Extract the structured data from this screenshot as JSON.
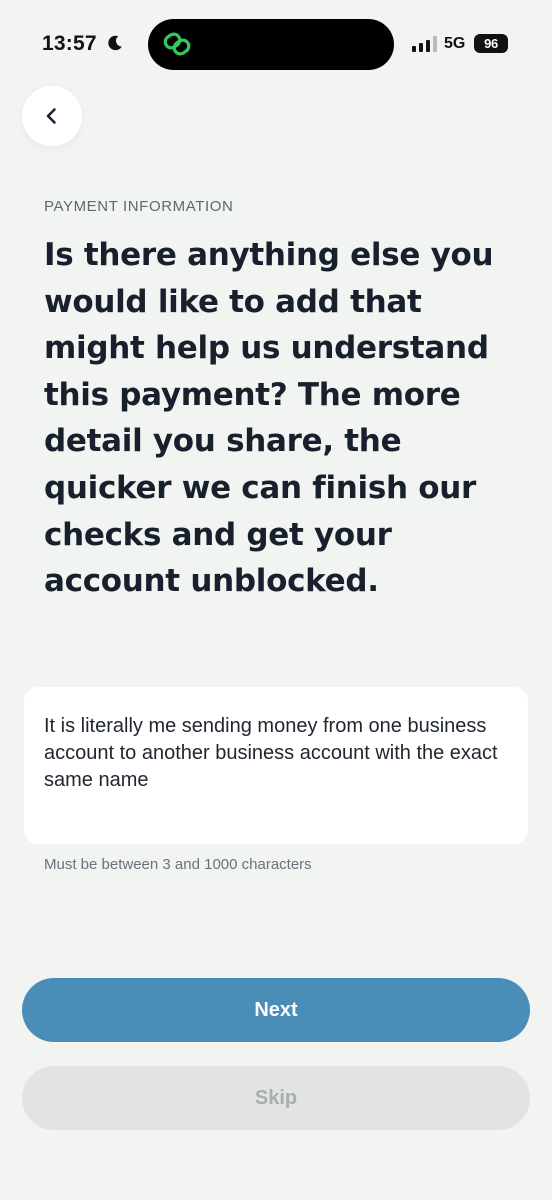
{
  "status_bar": {
    "time": "13:57",
    "network": "5G",
    "battery": "96"
  },
  "icons": {
    "moon": "moon-icon",
    "app": "link-icon",
    "signal": "signal-icon",
    "back": "chevron-left-icon"
  },
  "colors": {
    "primary": "#4a8db6",
    "background": "#f1f4f1",
    "app_icon": "#34c759"
  },
  "header": {
    "eyebrow": "PAYMENT INFORMATION",
    "question": "Is there anything else you would like to add that might help us understand this payment? The more detail you share, the quicker we can finish our checks and get your account unblocked."
  },
  "form": {
    "details_value": "It is literally me sending money from one business account to another business account with the exact same name",
    "helper": "Must be between 3 and 1000 characters"
  },
  "actions": {
    "next_label": "Next",
    "skip_label": "Skip"
  }
}
